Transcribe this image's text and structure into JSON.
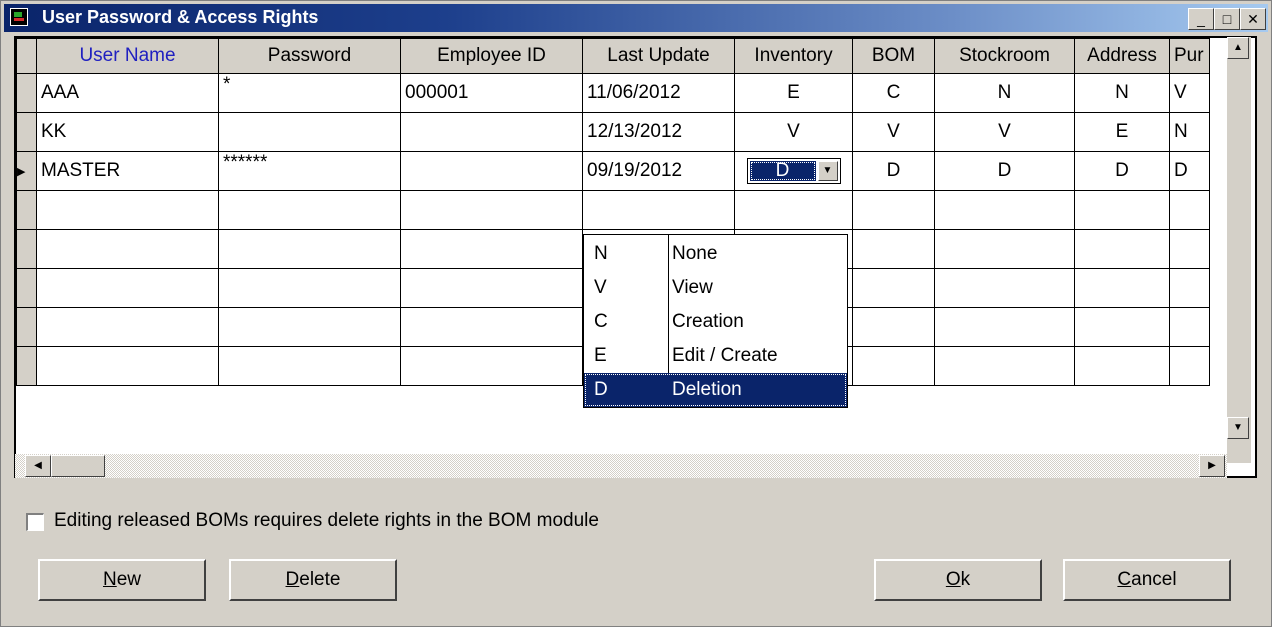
{
  "window": {
    "title": "User Password & Access Rights",
    "min_glyph": "_",
    "max_glyph": "□",
    "close_glyph": "✕"
  },
  "grid": {
    "columns": [
      "User Name",
      "Password",
      "Employee ID",
      "Last Update",
      "Inventory",
      "BOM",
      "Stockroom",
      "Address",
      "Pur"
    ],
    "rows": [
      {
        "user": "AAA",
        "password": "*",
        "employee_id": "000001",
        "last_update": "11/06/2012",
        "inventory": "E",
        "bom": "C",
        "stockroom": "N",
        "address": "N",
        "pur": "V"
      },
      {
        "user": "KK",
        "password": "",
        "employee_id": "",
        "last_update": "12/13/2012",
        "inventory": "V",
        "bom": "V",
        "stockroom": "V",
        "address": "E",
        "pur": "N"
      },
      {
        "user": "MASTER",
        "password": "******",
        "employee_id": "",
        "last_update": "09/19/2012",
        "inventory": "D",
        "bom": "D",
        "stockroom": "D",
        "address": "D",
        "pur": "D"
      }
    ],
    "current_row_marker": "▶"
  },
  "inventory_dropdown": {
    "options": [
      {
        "code": "N",
        "label": "None"
      },
      {
        "code": "V",
        "label": "View"
      },
      {
        "code": "C",
        "label": "Creation"
      },
      {
        "code": "E",
        "label": "Edit / Create"
      },
      {
        "code": "D",
        "label": "Deletion"
      }
    ],
    "selected": "D"
  },
  "checkbox": {
    "label": "Editing released BOMs requires delete rights in the BOM module",
    "checked": false
  },
  "buttons": {
    "new": {
      "mnemonic": "N",
      "rest": "ew"
    },
    "delete": {
      "mnemonic": "D",
      "rest": "elete"
    },
    "ok": {
      "mnemonic": "O",
      "rest": "k"
    },
    "cancel": {
      "mnemonic": "C",
      "rest": "ancel"
    }
  }
}
